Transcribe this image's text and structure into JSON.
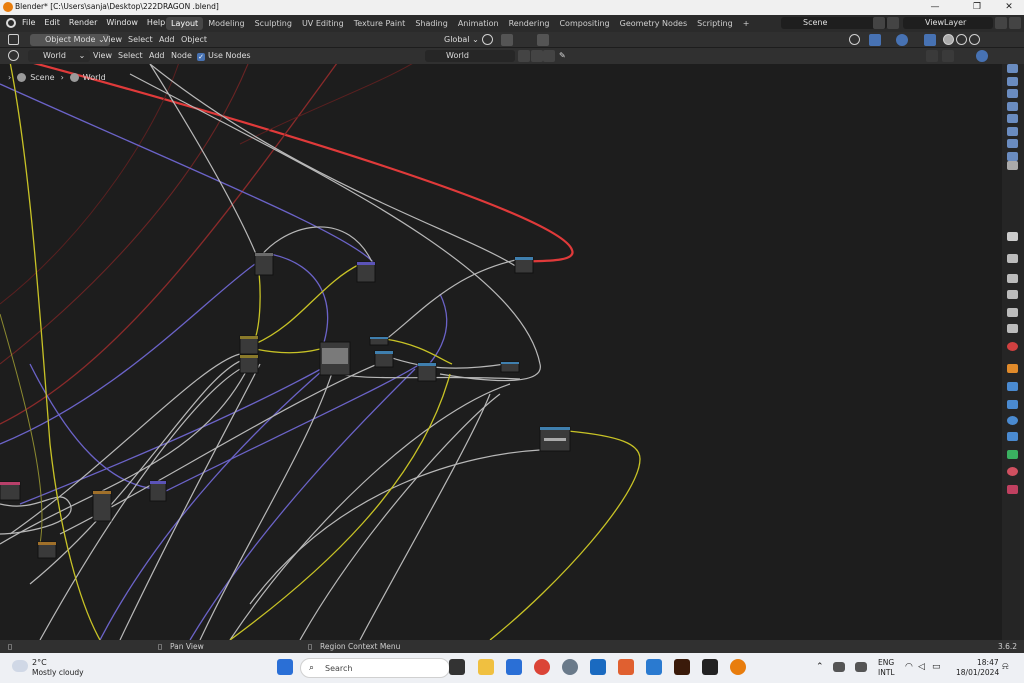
{
  "window": {
    "title": "Blender* [C:\\Users\\sanja\\Desktop\\222DRAGON .blend]"
  },
  "topbar": {
    "menu": [
      "File",
      "Edit",
      "Render",
      "Window",
      "Help"
    ],
    "workspaces": [
      "Layout",
      "Modeling",
      "Sculpting",
      "UV Editing",
      "Texture Paint",
      "Shading",
      "Animation",
      "Rendering",
      "Compositing",
      "Geometry Nodes",
      "Scripting"
    ],
    "active_workspace": "Layout",
    "add_tab": "+",
    "scene": "Scene",
    "view_layer": "ViewLayer"
  },
  "editor_header": {
    "mode": "Object Mode",
    "menu": [
      "View",
      "Select",
      "Add",
      "Object"
    ],
    "transform_orientation": "Global"
  },
  "node_header": {
    "shader_type": "World",
    "menu": [
      "View",
      "Select",
      "Add",
      "Node"
    ],
    "use_nodes_label": "Use Nodes",
    "use_nodes_checked": true,
    "datablock": "World"
  },
  "breadcrumb": [
    "Scene",
    "World"
  ],
  "statusbar": {
    "left": "Pan View",
    "middle": "Region Context Menu",
    "version": "3.6.2"
  },
  "taskbar": {
    "weather_temp": "2°C",
    "weather_desc": "Mostly cloudy",
    "search_placeholder": "Search",
    "lang": "ENG",
    "layout": "INTL",
    "time": "18:47",
    "date": "18/01/2024"
  },
  "colors": {
    "accent": "#4772b3",
    "wire_gray": "#b8b8b8",
    "wire_purple": "#6b63c8",
    "wire_yellow": "#c8c326",
    "wire_red": "#d93a3a"
  }
}
